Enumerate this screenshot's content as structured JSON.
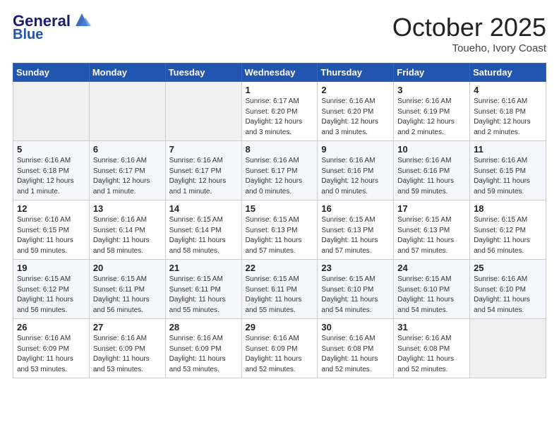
{
  "header": {
    "logo_line1": "General",
    "logo_line2": "Blue",
    "month_title": "October 2025",
    "location": "Toueho, Ivory Coast"
  },
  "days_of_week": [
    "Sunday",
    "Monday",
    "Tuesday",
    "Wednesday",
    "Thursday",
    "Friday",
    "Saturday"
  ],
  "weeks": [
    [
      {
        "day": "",
        "info": ""
      },
      {
        "day": "",
        "info": ""
      },
      {
        "day": "",
        "info": ""
      },
      {
        "day": "1",
        "info": "Sunrise: 6:17 AM\nSunset: 6:20 PM\nDaylight: 12 hours and 3 minutes."
      },
      {
        "day": "2",
        "info": "Sunrise: 6:16 AM\nSunset: 6:20 PM\nDaylight: 12 hours and 3 minutes."
      },
      {
        "day": "3",
        "info": "Sunrise: 6:16 AM\nSunset: 6:19 PM\nDaylight: 12 hours and 2 minutes."
      },
      {
        "day": "4",
        "info": "Sunrise: 6:16 AM\nSunset: 6:18 PM\nDaylight: 12 hours and 2 minutes."
      }
    ],
    [
      {
        "day": "5",
        "info": "Sunrise: 6:16 AM\nSunset: 6:18 PM\nDaylight: 12 hours and 1 minute."
      },
      {
        "day": "6",
        "info": "Sunrise: 6:16 AM\nSunset: 6:17 PM\nDaylight: 12 hours and 1 minute."
      },
      {
        "day": "7",
        "info": "Sunrise: 6:16 AM\nSunset: 6:17 PM\nDaylight: 12 hours and 1 minute."
      },
      {
        "day": "8",
        "info": "Sunrise: 6:16 AM\nSunset: 6:17 PM\nDaylight: 12 hours and 0 minutes."
      },
      {
        "day": "9",
        "info": "Sunrise: 6:16 AM\nSunset: 6:16 PM\nDaylight: 12 hours and 0 minutes."
      },
      {
        "day": "10",
        "info": "Sunrise: 6:16 AM\nSunset: 6:16 PM\nDaylight: 11 hours and 59 minutes."
      },
      {
        "day": "11",
        "info": "Sunrise: 6:16 AM\nSunset: 6:15 PM\nDaylight: 11 hours and 59 minutes."
      }
    ],
    [
      {
        "day": "12",
        "info": "Sunrise: 6:16 AM\nSunset: 6:15 PM\nDaylight: 11 hours and 59 minutes."
      },
      {
        "day": "13",
        "info": "Sunrise: 6:16 AM\nSunset: 6:14 PM\nDaylight: 11 hours and 58 minutes."
      },
      {
        "day": "14",
        "info": "Sunrise: 6:15 AM\nSunset: 6:14 PM\nDaylight: 11 hours and 58 minutes."
      },
      {
        "day": "15",
        "info": "Sunrise: 6:15 AM\nSunset: 6:13 PM\nDaylight: 11 hours and 57 minutes."
      },
      {
        "day": "16",
        "info": "Sunrise: 6:15 AM\nSunset: 6:13 PM\nDaylight: 11 hours and 57 minutes."
      },
      {
        "day": "17",
        "info": "Sunrise: 6:15 AM\nSunset: 6:13 PM\nDaylight: 11 hours and 57 minutes."
      },
      {
        "day": "18",
        "info": "Sunrise: 6:15 AM\nSunset: 6:12 PM\nDaylight: 11 hours and 56 minutes."
      }
    ],
    [
      {
        "day": "19",
        "info": "Sunrise: 6:15 AM\nSunset: 6:12 PM\nDaylight: 11 hours and 56 minutes."
      },
      {
        "day": "20",
        "info": "Sunrise: 6:15 AM\nSunset: 6:11 PM\nDaylight: 11 hours and 56 minutes."
      },
      {
        "day": "21",
        "info": "Sunrise: 6:15 AM\nSunset: 6:11 PM\nDaylight: 11 hours and 55 minutes."
      },
      {
        "day": "22",
        "info": "Sunrise: 6:15 AM\nSunset: 6:11 PM\nDaylight: 11 hours and 55 minutes."
      },
      {
        "day": "23",
        "info": "Sunrise: 6:15 AM\nSunset: 6:10 PM\nDaylight: 11 hours and 54 minutes."
      },
      {
        "day": "24",
        "info": "Sunrise: 6:15 AM\nSunset: 6:10 PM\nDaylight: 11 hours and 54 minutes."
      },
      {
        "day": "25",
        "info": "Sunrise: 6:16 AM\nSunset: 6:10 PM\nDaylight: 11 hours and 54 minutes."
      }
    ],
    [
      {
        "day": "26",
        "info": "Sunrise: 6:16 AM\nSunset: 6:09 PM\nDaylight: 11 hours and 53 minutes."
      },
      {
        "day": "27",
        "info": "Sunrise: 6:16 AM\nSunset: 6:09 PM\nDaylight: 11 hours and 53 minutes."
      },
      {
        "day": "28",
        "info": "Sunrise: 6:16 AM\nSunset: 6:09 PM\nDaylight: 11 hours and 53 minutes."
      },
      {
        "day": "29",
        "info": "Sunrise: 6:16 AM\nSunset: 6:09 PM\nDaylight: 11 hours and 52 minutes."
      },
      {
        "day": "30",
        "info": "Sunrise: 6:16 AM\nSunset: 6:08 PM\nDaylight: 11 hours and 52 minutes."
      },
      {
        "day": "31",
        "info": "Sunrise: 6:16 AM\nSunset: 6:08 PM\nDaylight: 11 hours and 52 minutes."
      },
      {
        "day": "",
        "info": ""
      }
    ]
  ]
}
